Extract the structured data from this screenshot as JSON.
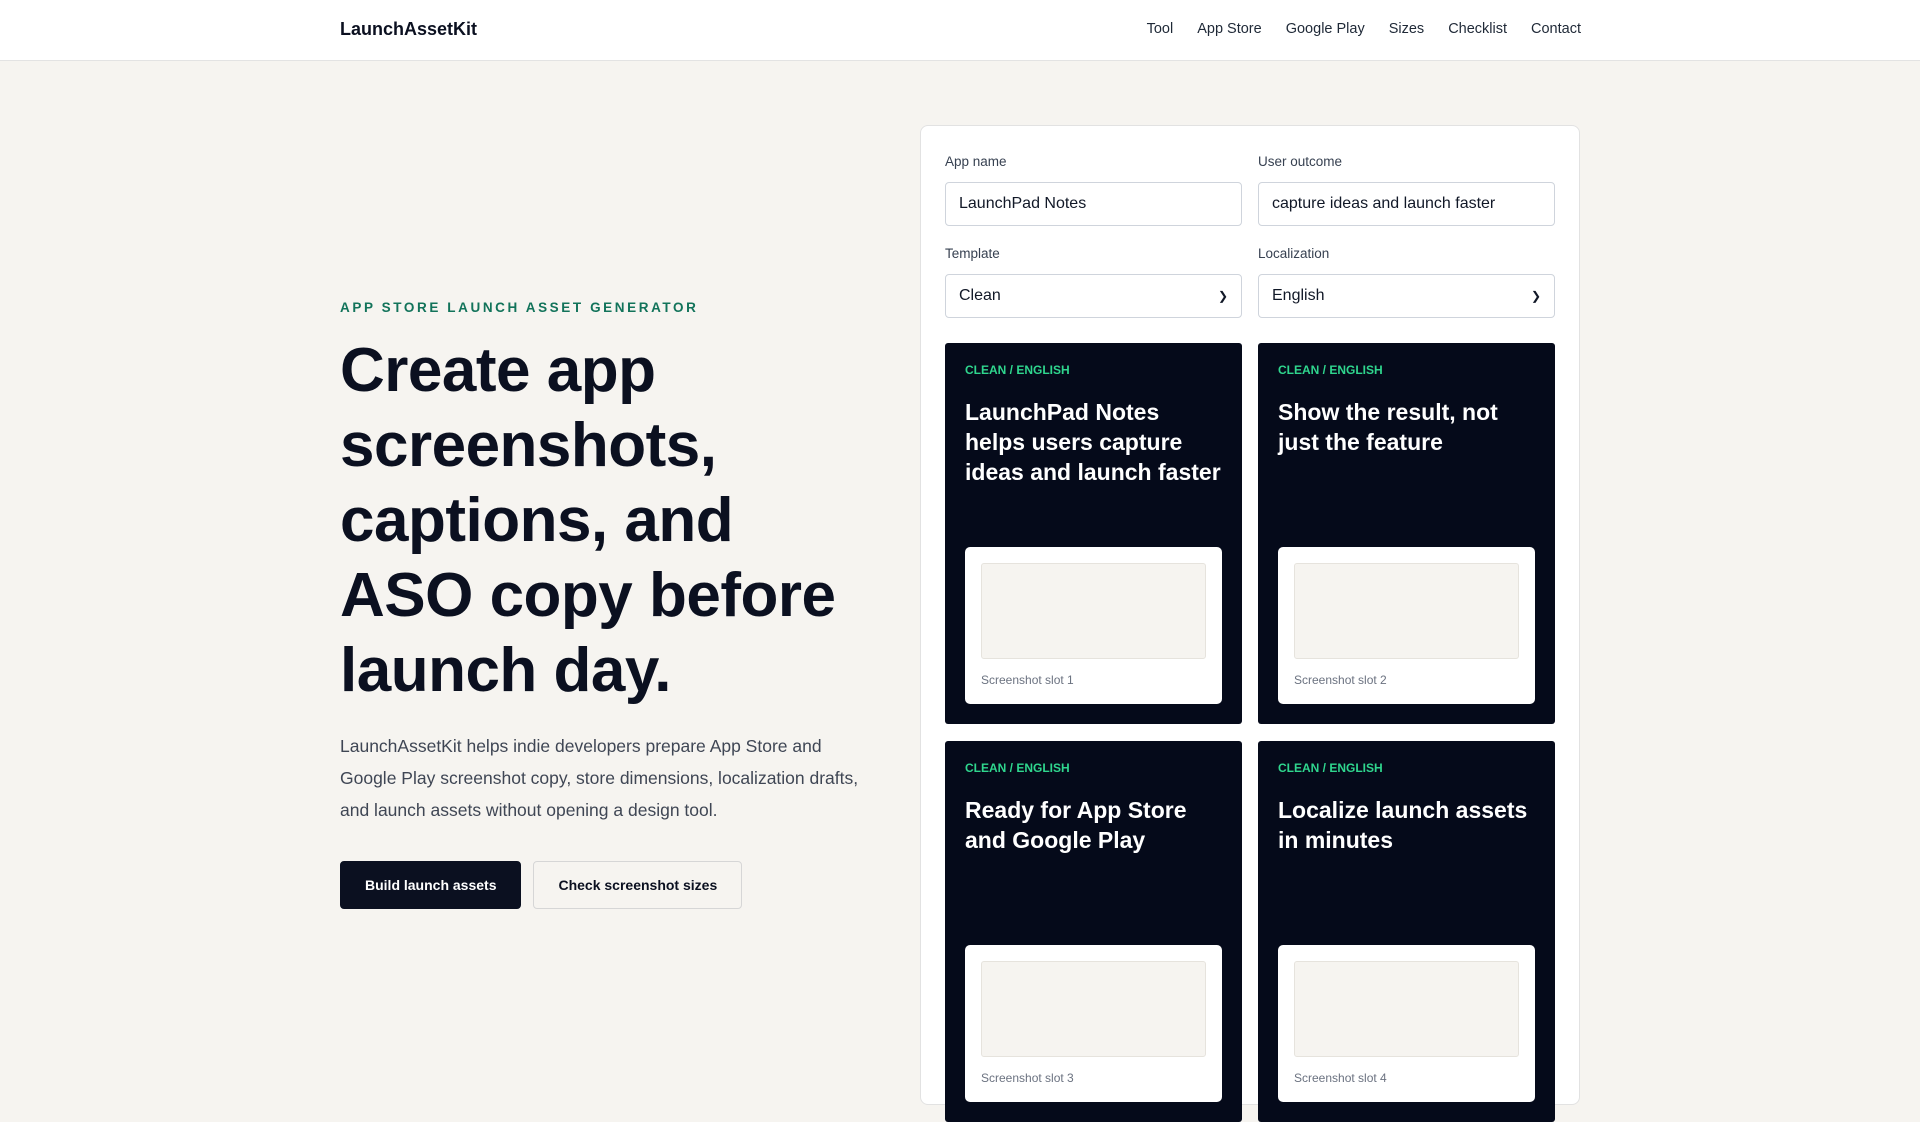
{
  "header": {
    "brand": "LaunchAssetKit",
    "nav": [
      "Tool",
      "App Store",
      "Google Play",
      "Sizes",
      "Checklist",
      "Contact"
    ]
  },
  "hero": {
    "eyebrow": "App Store Launch Asset Generator",
    "title": "Create app screenshots, captions, and ASO copy before launch day.",
    "description": "LaunchAssetKit helps indie developers prepare App Store and Google Play screenshot copy, store dimensions, localization drafts, and launch assets without opening a design tool.",
    "primary_button": "Build launch assets",
    "secondary_button": "Check screenshot sizes"
  },
  "form": {
    "app_name_label": "App name",
    "app_name_value": "LaunchPad Notes",
    "user_outcome_label": "User outcome",
    "user_outcome_value": "capture ideas and launch faster",
    "template_label": "Template",
    "template_value": "Clean",
    "localization_label": "Localization",
    "localization_value": "English"
  },
  "cards": [
    {
      "tag": "CLEAN / ENGLISH",
      "headline": "LaunchPad Notes helps users capture ideas and launch faster",
      "slot": "Screenshot slot 1"
    },
    {
      "tag": "CLEAN / ENGLISH",
      "headline": "Show the result, not just the feature",
      "slot": "Screenshot slot 2"
    },
    {
      "tag": "CLEAN / ENGLISH",
      "headline": "Ready for App Store and Google Play",
      "slot": "Screenshot slot 3"
    },
    {
      "tag": "CLEAN / ENGLISH",
      "headline": "Localize launch assets in minutes",
      "slot": "Screenshot slot 4"
    }
  ],
  "colors": {
    "background": "#f6f4f0",
    "accent_green": "#12735a",
    "card_dark": "#050a1a",
    "tag_green": "#2fd68e"
  }
}
